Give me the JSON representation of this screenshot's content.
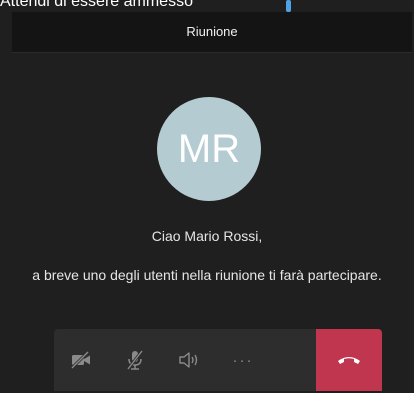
{
  "caption": {
    "text": "Attendi di essere ammesso"
  },
  "header": {
    "title": "Riunione"
  },
  "participant": {
    "initials": "MR",
    "avatar_color": "#b5cbd2"
  },
  "lobby": {
    "greeting": "Ciao Mario Rossi,",
    "message": "a breve uno degli utenti nella riunione ti farà partecipare."
  },
  "controls": {
    "camera_icon": "camera-off-icon",
    "mic_icon": "microphone-off-icon",
    "speaker_icon": "speaker-icon",
    "more_label": "···",
    "hangup_icon": "phone-hangup-icon",
    "hangup_color": "#c0364e"
  }
}
